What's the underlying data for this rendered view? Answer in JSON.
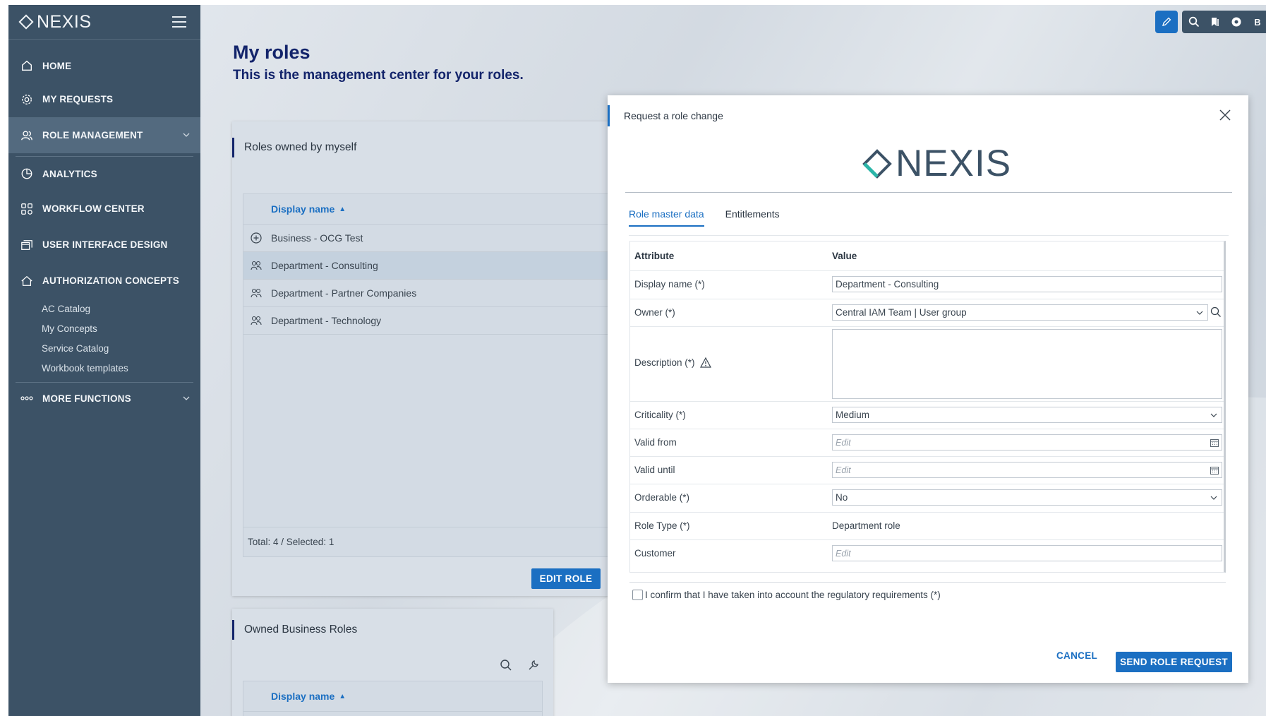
{
  "app": {
    "brand": "NEXIS"
  },
  "sidebar": {
    "items": [
      {
        "label": "HOME",
        "icon": "home-icon"
      },
      {
        "label": "MY REQUESTS",
        "icon": "gear-icon"
      },
      {
        "label": "ROLE MANAGEMENT",
        "icon": "users-icon"
      },
      {
        "label": "ANALYTICS",
        "icon": "pie-chart-icon"
      },
      {
        "label": "WORKFLOW CENTER",
        "icon": "workflow-icon"
      },
      {
        "label": "USER INTERFACE DESIGN",
        "icon": "window-icon"
      },
      {
        "label": "AUTHORIZATION CONCEPTS",
        "icon": "home-outline-icon"
      },
      {
        "label": "MORE FUNCTIONS",
        "icon": "dots-icon"
      }
    ],
    "subitems": [
      "AC Catalog",
      "My Concepts",
      "Service Catalog",
      "Workbook templates"
    ]
  },
  "toolbar": {
    "user_initial": "B"
  },
  "page": {
    "title": "My roles",
    "subtitle": "This is the management center for your roles."
  },
  "roles_card": {
    "title": "Roles owned by myself",
    "column": "Display name",
    "rows": [
      {
        "label": "Business - OCG Test",
        "icon": "add-circle-icon"
      },
      {
        "label": "Department - Consulting",
        "icon": "users-icon",
        "selected": true
      },
      {
        "label": "Department - Partner Companies",
        "icon": "users-icon"
      },
      {
        "label": "Department - Technology",
        "icon": "users-icon"
      }
    ],
    "footer": "Total: 4 / Selected: 1",
    "edit_button": "EDIT ROLE"
  },
  "business_card": {
    "title": "Owned Business Roles",
    "column": "Display name"
  },
  "dialog": {
    "title": "Request a role change",
    "logo": "NEXIS",
    "tabs": [
      "Role master data",
      "Entitlements"
    ],
    "form": {
      "header_attribute": "Attribute",
      "header_value": "Value",
      "display_name_label": "Display name (*)",
      "display_name_value": "Department - Consulting",
      "owner_label": "Owner (*)",
      "owner_value": "Central IAM Team | User group",
      "description_label": "Description (*)",
      "criticality_label": "Criticality (*)",
      "criticality_value": "Medium",
      "valid_from_label": "Valid from",
      "valid_from_placeholder": "Edit",
      "valid_until_label": "Valid until",
      "valid_until_placeholder": "Edit",
      "orderable_label": "Orderable (*)",
      "orderable_value": "No",
      "role_type_label": "Role Type (*)",
      "role_type_value": "Department role",
      "customer_label": "Customer",
      "customer_placeholder": "Edit"
    },
    "confirm_text": "I confirm that I have taken into account the regulatory requirements (*)",
    "cancel": "CANCEL",
    "send": "SEND ROLE REQUEST"
  },
  "colors": {
    "sidebar": "#3c5266",
    "accent": "#1b6fc2",
    "title": "#13246b"
  }
}
